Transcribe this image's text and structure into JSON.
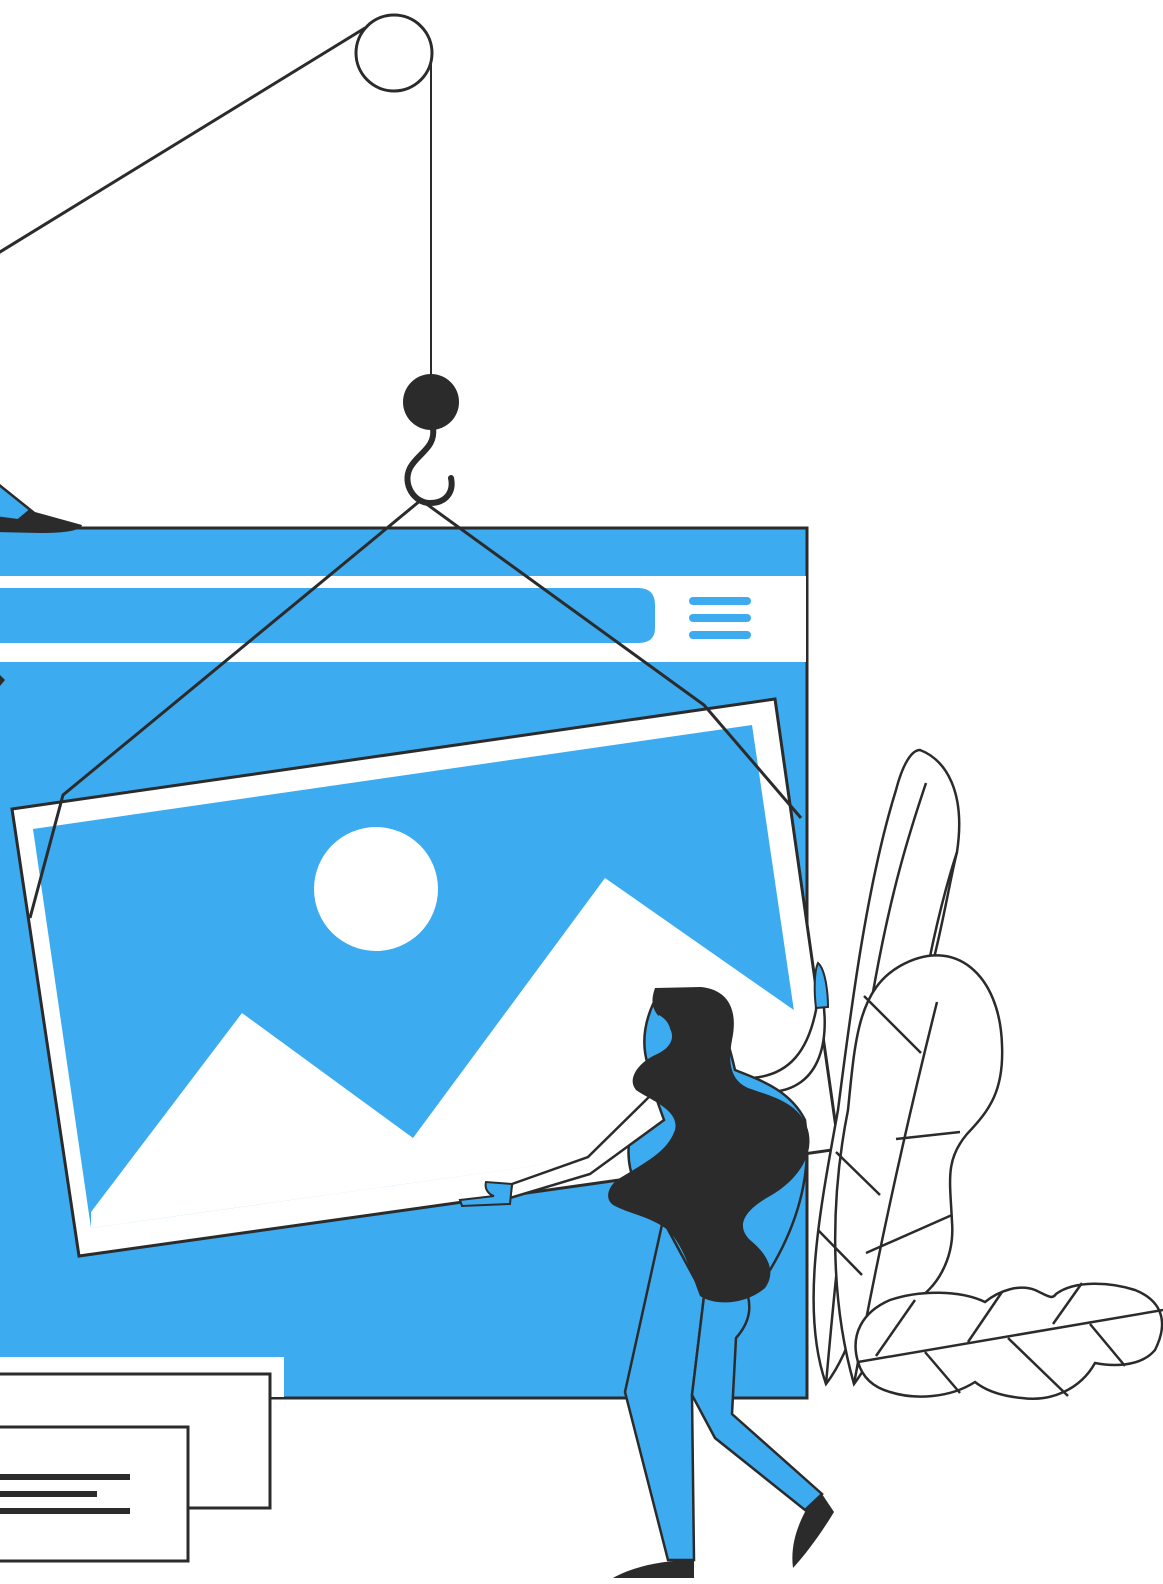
{
  "illustration": {
    "subject": "crane-lifting-image-frame-into-website",
    "colors": {
      "primary": "#3DABEF",
      "outline": "#2B2B2B",
      "background": "#FFFFFF"
    },
    "icons": [
      "pulley-icon",
      "crane-hook-icon",
      "hamburger-menu-icon",
      "image-placeholder-icon",
      "sun-icon",
      "mountains-icon",
      "leaf-icon"
    ]
  }
}
